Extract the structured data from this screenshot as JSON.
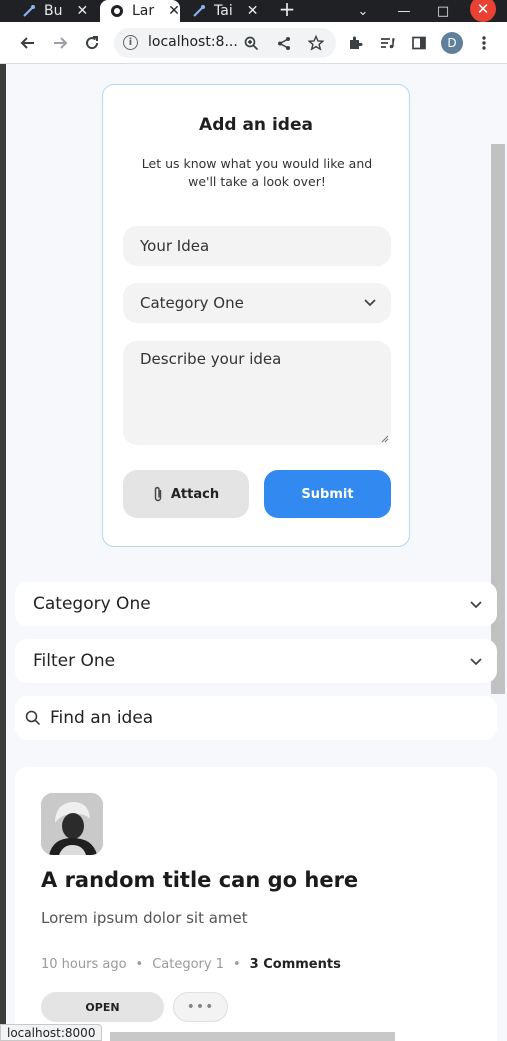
{
  "browser": {
    "tabs": [
      {
        "label": "Bu",
        "active": false
      },
      {
        "label": "Lar",
        "active": true
      },
      {
        "label": "Tai",
        "active": false
      }
    ],
    "url": "localhost:8...",
    "profile_initial": "D",
    "status_url": "localhost:8000"
  },
  "add_idea": {
    "title": "Add an idea",
    "subtitle": "Let us know what you would like and we'll take a look over!",
    "title_placeholder": "Your Idea",
    "category_value": "Category One",
    "description_placeholder": "Describe your idea",
    "attach_label": "Attach",
    "submit_label": "Submit"
  },
  "filters": {
    "category_value": "Category One",
    "filter_value": "Filter One",
    "search_placeholder": "Find an idea"
  },
  "idea": {
    "title": "A random title can go here",
    "description": "Lorem ipsum dolor sit amet",
    "time_ago": "10 hours ago",
    "category": "Category 1",
    "comments": "3 Comments",
    "status": "OPEN",
    "more_label": "•••"
  },
  "colors": {
    "accent": "#328af1",
    "background": "#f7f8fc"
  }
}
